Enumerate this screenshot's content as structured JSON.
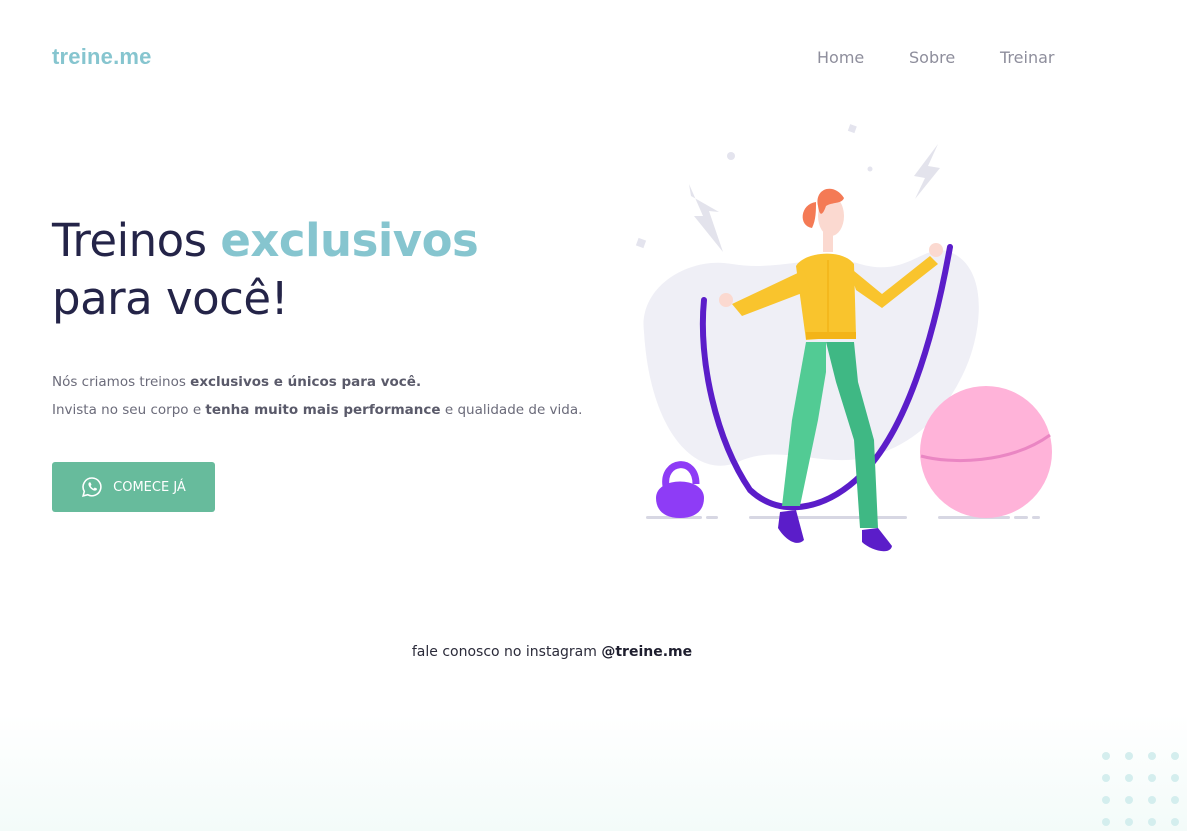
{
  "brand": {
    "logo": "treine.me"
  },
  "nav": {
    "items": [
      "Home",
      "Sobre",
      "Treinar"
    ]
  },
  "hero": {
    "title_part1": "Treinos ",
    "title_accent": "exclusivos",
    "title_part2": "para você!",
    "line1_plain": "Nós criamos treinos ",
    "line1_bold": "exclusivos e únicos para você.",
    "line2_plain1": "Invista no seu corpo e ",
    "line2_bold": "tenha muito mais performance",
    "line2_plain2": " e qualidade de vida.",
    "cta_label": "COMECE JÁ",
    "cta_icon": "whatsapp-icon"
  },
  "footer": {
    "note_plain": "fale conosco no instagram ",
    "note_handle": "@treine.me"
  },
  "colors": {
    "accent": "#86c5cf",
    "cta": "#67bb9c",
    "headline": "#242448",
    "rope": "#5b1dc9",
    "jacket": "#f9c42d",
    "pants": "#52cb94",
    "ball": "#ffb3d9",
    "kettlebell": "#8e3cf6"
  }
}
